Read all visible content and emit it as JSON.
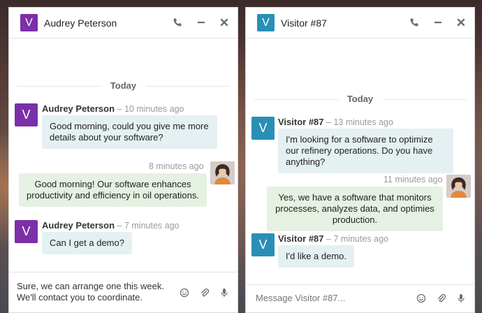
{
  "colors": {
    "purple": "#7b2fa8",
    "teal": "#2a8fb5",
    "incoming_bubble": "#e5f0f2",
    "outgoing_bubble": "#e5f1e2"
  },
  "icons": [
    "phone-icon",
    "minimize-icon",
    "close-icon",
    "emoji-icon",
    "paperclip-icon",
    "microphone-icon"
  ],
  "chats": [
    {
      "header": {
        "avatar_letter": "V",
        "title": "Audrey Peterson"
      },
      "day_separator": "Today",
      "messages": [
        {
          "sender": "Audrey Peterson",
          "time": "10 minutes ago",
          "text": "Good morning, could you give me more details about your software?"
        },
        {
          "time": "8 minutes ago",
          "text": "Good morning! Our software enhances productivity and efficiency in oil operations."
        },
        {
          "sender": "Audrey Peterson",
          "time": "7 minutes ago",
          "text": "Can I get a demo?"
        }
      ],
      "composer": {
        "value": "Sure, we can arrange one this week. We'll contact you to coordinate."
      }
    },
    {
      "header": {
        "avatar_letter": "V",
        "title": "Visitor #87"
      },
      "day_separator": "Today",
      "messages": [
        {
          "sender": "Visitor #87",
          "time": "13 minutes ago",
          "text": "I'm looking for a software to optimize our refinery operations. Do you have anything?"
        },
        {
          "time": "11 minutes ago",
          "text": "Yes, we have a software that monitors processes, analyzes data, and optimies production."
        },
        {
          "sender": "Visitor #87",
          "time": "7 minutes ago",
          "text": "I'd like a demo."
        }
      ],
      "composer": {
        "placeholder": "Message Visitor #87..."
      }
    }
  ]
}
